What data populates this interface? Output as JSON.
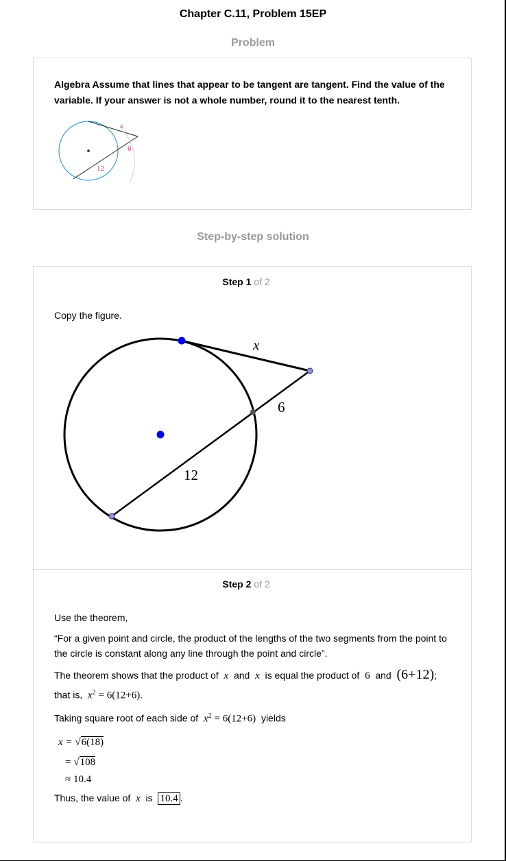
{
  "page": {
    "chapter_title": "Chapter C.11, Problem 15EP",
    "problem_heading": "Problem",
    "solution_heading": "Step-by-step solution"
  },
  "problem": {
    "text": "Algebra Assume that lines that appear to be tangent are tangent. Find the value of the variable. If your answer is not a whole number, round it to the nearest tenth.",
    "figure_labels": {
      "x": "x",
      "six": "6",
      "twelve": "12"
    },
    "colors": {
      "circle": "#3aa0d8",
      "label": "#d23b7a"
    }
  },
  "steps": [
    {
      "label": "Step 1",
      "of": "of 2",
      "intro": "Copy the figure.",
      "figure_labels": {
        "x": "x",
        "six": "6",
        "twelve": "12"
      }
    },
    {
      "label": "Step 2",
      "of": "of 2",
      "line1": "Use the theorem,",
      "quote": "“For a given point and circle, the product of the lengths of the two segments from the point to the circle is constant along any line through the point and circle”.",
      "p3_a": "The theorem shows that the product of",
      "p3_x1": "x",
      "p3_and1": "and",
      "p3_x2": "x",
      "p3_b": "is equal the product of",
      "p3_six": "6",
      "p3_and2": "and",
      "p3_expr": "(6+12)",
      "p3_semi": ";",
      "p4_a": "that is,",
      "p4_lhs": "x",
      "p4_exp": "2",
      "p4_rhs": "= 6(12+6)",
      "p4_end": ".",
      "p5_a": "Taking square root of each side of",
      "p5_lhs": "x",
      "p5_exp": "2",
      "p5_rhs": "= 6(12+6)",
      "p5_b": "yields",
      "calc1_lhs": "x =",
      "calc1_rad": "6(18)",
      "calc2_op": "=",
      "calc2_rad": "108",
      "calc3": "≈ 10.4",
      "final_a": "Thus, the value of",
      "final_x": "x",
      "final_is": "is",
      "final_answer": "10.4",
      "final_end": "."
    }
  ]
}
